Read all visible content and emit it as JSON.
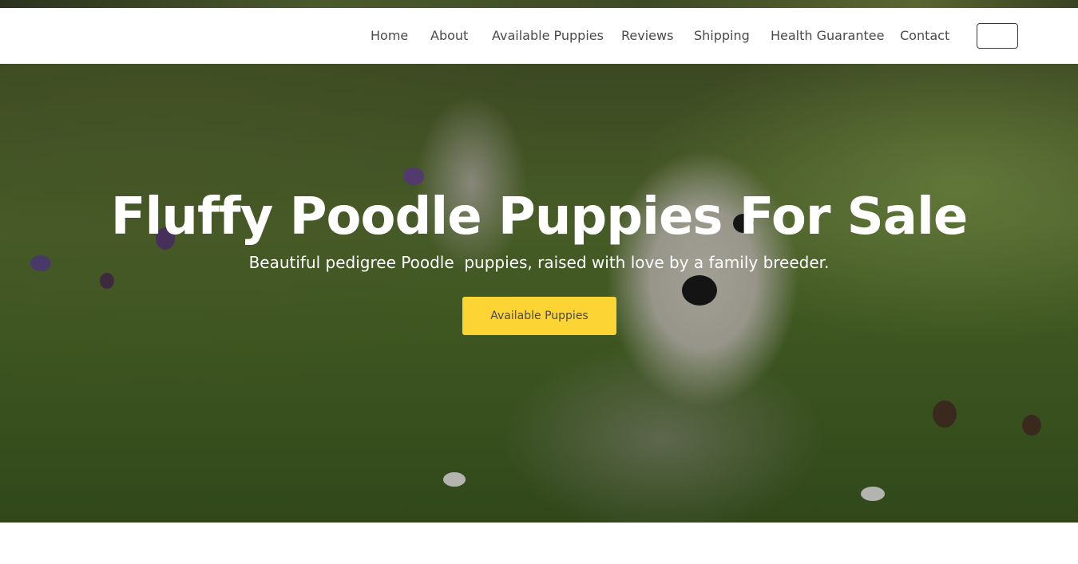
{
  "nav": {
    "items": [
      {
        "label": "Home"
      },
      {
        "label": "About"
      },
      {
        "label": "Available Puppies"
      },
      {
        "label": "Reviews"
      },
      {
        "label": "Shipping"
      },
      {
        "label": "Health Guarantee"
      },
      {
        "label": "Contact"
      }
    ],
    "button_label": ""
  },
  "hero": {
    "title": "Fluffy Poodle Puppies For Sale",
    "subtitle": "Beautiful pedigree Poodle  puppies, raised with love by a family breeder.",
    "cta_label": "Available Puppies",
    "cta_color": "#fcd535"
  }
}
